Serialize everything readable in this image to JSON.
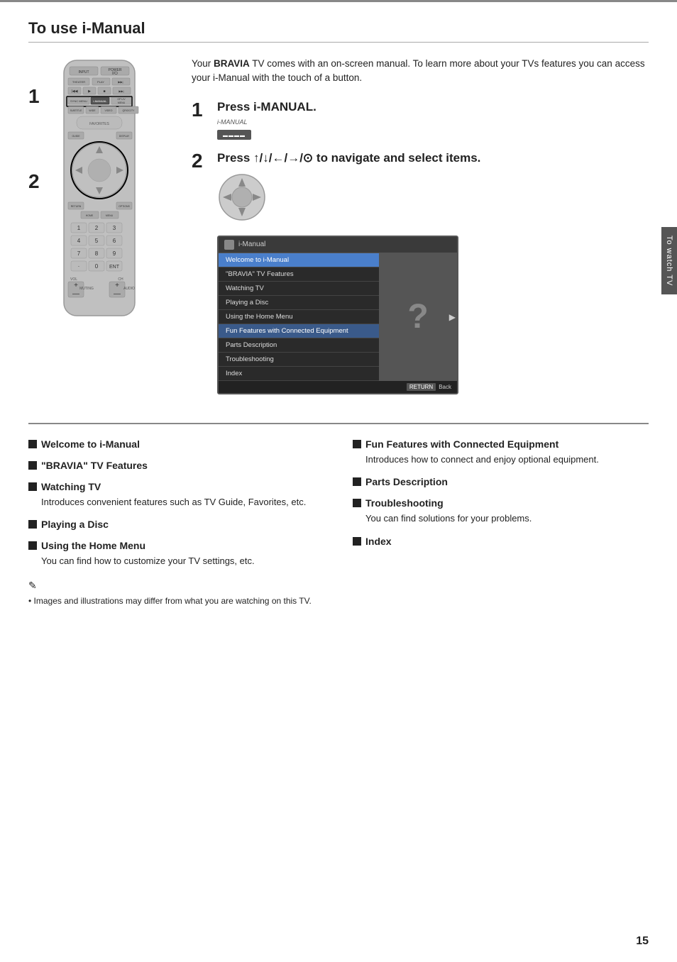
{
  "page": {
    "title": "To use i-Manual",
    "side_tab": "To watch TV",
    "page_number": "15"
  },
  "intro": {
    "text1": "Your ",
    "brand": "BRAVIA",
    "text2": " TV comes with an on-screen manual. To learn more about your TVs features you can access your i-Manual with the touch of a button."
  },
  "step1": {
    "number": "1",
    "title": "Press i-MANUAL.",
    "button_label": "i-MANUAL"
  },
  "step2": {
    "number": "2",
    "title": "Press ↑/↓/←/→/⊙ to navigate and select items."
  },
  "screen": {
    "header": "i-Manual",
    "items": [
      {
        "label": "Welcome to i-Manual",
        "state": "highlighted"
      },
      {
        "label": "\"BRAVIA\" TV Features",
        "state": "normal"
      },
      {
        "label": "Watching TV",
        "state": "normal"
      },
      {
        "label": "Playing a Disc",
        "state": "normal"
      },
      {
        "label": "Using the Home Menu",
        "state": "normal"
      },
      {
        "label": "Fun Features with Connected Equipment",
        "state": "active"
      },
      {
        "label": "Parts Description",
        "state": "normal"
      },
      {
        "label": "Troubleshooting",
        "state": "normal"
      },
      {
        "label": "Index",
        "state": "normal"
      }
    ],
    "return_button": "RETURN",
    "back_label": "Back"
  },
  "features": {
    "left": [
      {
        "title": "Welcome to i-Manual",
        "desc": ""
      },
      {
        "title": "\"BRAVIA\" TV Features",
        "desc": ""
      },
      {
        "title": "Watching TV",
        "desc": "Introduces convenient features such as TV Guide, Favorites, etc."
      },
      {
        "title": "Playing a Disc",
        "desc": ""
      },
      {
        "title": "Using the Home Menu",
        "desc": "You can find how to customize your TV settings, etc."
      }
    ],
    "right": [
      {
        "title": "Fun Features with Connected Equipment",
        "desc": "Introduces how to connect and enjoy optional equipment."
      },
      {
        "title": "Parts Description",
        "desc": ""
      },
      {
        "title": "Troubleshooting",
        "desc": "You can find solutions for your problems."
      },
      {
        "title": "Index",
        "desc": ""
      }
    ]
  },
  "note": {
    "icon": "✎",
    "bullet": "•",
    "text": "Images and illustrations may differ from what you are watching on this TV."
  }
}
